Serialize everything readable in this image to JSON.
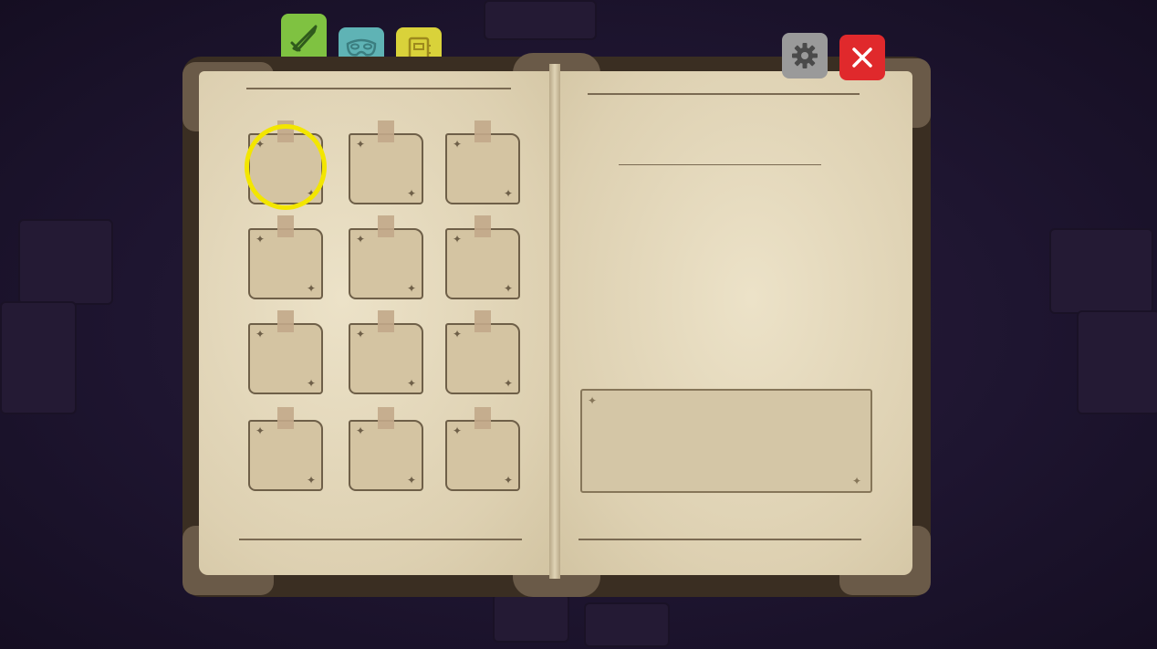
{
  "tabs": [
    {
      "name": "weapons-tab",
      "icon": "sword-icon",
      "color": "#7fc241",
      "active": true
    },
    {
      "name": "masks-tab",
      "icon": "mask-icon",
      "color": "#5fb3b5",
      "active": false
    },
    {
      "name": "journal-tab",
      "icon": "notebook-icon",
      "color": "#d9d23a",
      "active": false
    }
  ],
  "buttons": {
    "settings": {
      "icon": "gear-icon",
      "color": "#9a9a9a"
    },
    "close": {
      "icon": "close-icon",
      "color": "#e0292c"
    }
  },
  "inventory": {
    "rows": 4,
    "cols": 3,
    "selected_index": 0,
    "slots": [
      "",
      "",
      "",
      "",
      "",
      "",
      "",
      "",
      "",
      "",
      "",
      ""
    ]
  },
  "detail": {
    "item_title": "",
    "item_description": ""
  },
  "colors": {
    "highlight": "#f3e600",
    "parchment": "#e3d8bd",
    "background": "#1e1530"
  }
}
